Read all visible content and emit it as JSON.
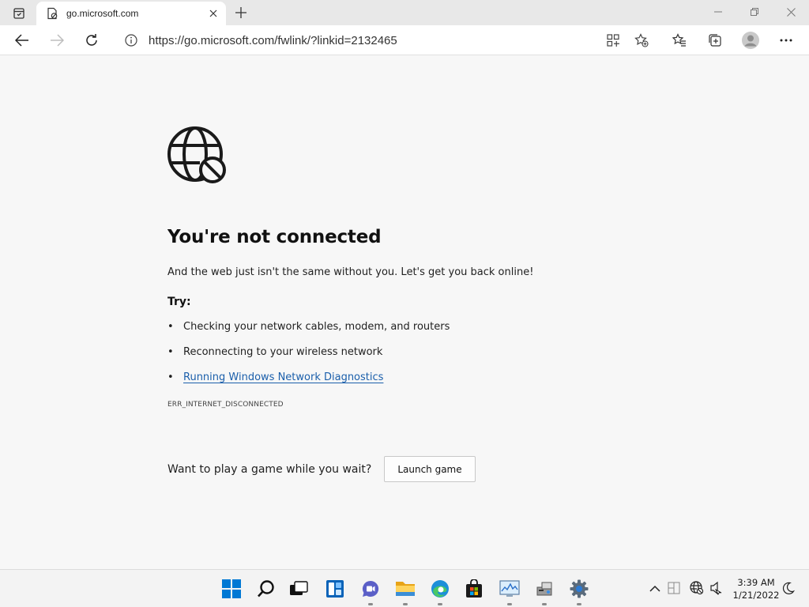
{
  "browser": {
    "tab": {
      "title": "go.microsoft.com"
    },
    "address_bar": {
      "url": "https://go.microsoft.com/fwlink/?linkid=2132465"
    }
  },
  "page": {
    "heading": "You're not connected",
    "subtext": "And the web just isn't the same without you. Let's get you back online!",
    "try_label": "Try:",
    "tips": [
      "Checking your network cables, modem, and routers",
      "Reconnecting to your wireless network",
      "Running Windows Network Diagnostics"
    ],
    "error_code": "ERR_INTERNET_DISCONNECTED",
    "game_prompt": "Want to play a game while you wait?",
    "launch_button": "Launch game"
  },
  "taskbar": {
    "apps": [
      "start",
      "search",
      "task-view",
      "widgets",
      "chat",
      "file-explorer",
      "edge",
      "store",
      "performance-monitor",
      "device-manager",
      "settings"
    ],
    "clock": {
      "time": "3:39 AM",
      "date": "1/21/2022"
    }
  },
  "colors": {
    "link": "#1b5fab",
    "windows_blue": "#0078d4"
  }
}
